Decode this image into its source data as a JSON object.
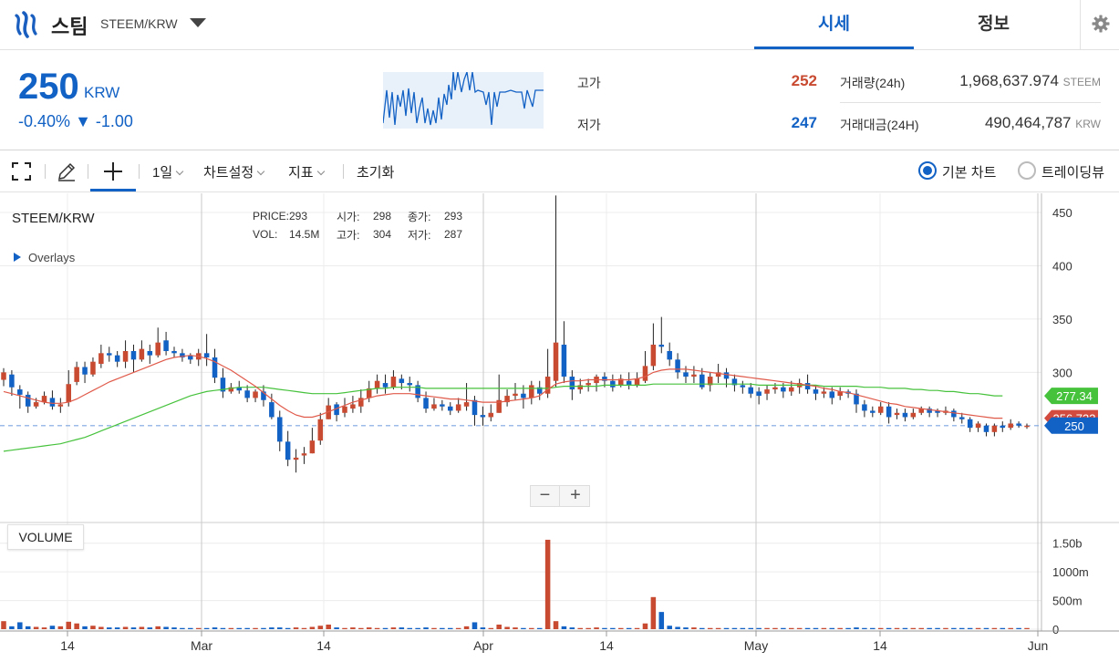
{
  "header": {
    "coin_name": "스팀",
    "pair": "STEEM/KRW",
    "tabs": [
      {
        "label": "시세",
        "active": true
      },
      {
        "label": "정보",
        "active": false
      }
    ]
  },
  "summary": {
    "price": "250",
    "unit": "KRW",
    "change_pct": "-0.40%",
    "change_abs": "▼ -1.00",
    "high_label": "고가",
    "high": "252",
    "low_label": "저가",
    "low": "247",
    "volume_label": "거래량(24h)",
    "volume": "1,968,637.974",
    "volume_unit": "STEEM",
    "amount_label": "거래대금(24H)",
    "amount": "490,464,787",
    "amount_unit": "KRW"
  },
  "toolbar": {
    "interval": "1일",
    "chart_settings": "차트설정",
    "indicators": "지표",
    "reset": "초기화",
    "basic_chart": "기본 차트",
    "tradingview": "트레이딩뷰"
  },
  "chart_panel": {
    "pair": "STEEM/KRW",
    "overlays": "Overlays",
    "volume_tag": "VOLUME",
    "legend": {
      "price_label": "PRICE:",
      "price": "293",
      "vol_label": "VOL:",
      "vol": "14.5M",
      "open_label": "시가:",
      "open": "298",
      "close_label": "종가:",
      "close": "293",
      "high_label": "고가:",
      "high": "304",
      "low_label": "저가:",
      "low": "287"
    },
    "zoom_out": "−",
    "zoom_in": "+"
  },
  "colors": {
    "up": "#c84a31",
    "down": "#1261c4",
    "ma_short": "#e05a4a",
    "ma_long": "#46c23c",
    "accent": "#1261c4"
  },
  "chart_data": {
    "type": "candlestick",
    "x_ticks": [
      "14",
      "Mar",
      "14",
      "Apr",
      "14",
      "May",
      "14",
      "Jun"
    ],
    "price_ticks": [
      450,
      400,
      350,
      300
    ],
    "price_ylim": [
      160,
      468
    ],
    "volume_ticks": [
      "1.50b",
      "1000m",
      "500m",
      "0"
    ],
    "volume_ylim": [
      0,
      1.75
    ],
    "current_price": 250,
    "ma_short_last": "256.733",
    "ma_long_last": "277.34",
    "candles": [
      [
        293,
        300,
        304,
        287,
        0.14
      ],
      [
        298,
        286,
        302,
        278,
        0.05
      ],
      [
        284,
        279,
        288,
        266,
        0.12
      ],
      [
        279,
        268,
        282,
        262,
        0.05
      ],
      [
        268,
        272,
        276,
        266,
        0.04
      ],
      [
        272,
        278,
        282,
        270,
        0.03
      ],
      [
        276,
        268,
        283,
        265,
        0.06
      ],
      [
        268,
        270,
        276,
        262,
        0.05
      ],
      [
        272,
        289,
        302,
        268,
        0.13
      ],
      [
        291,
        305,
        310,
        288,
        0.1
      ],
      [
        305,
        298,
        310,
        290,
        0.05
      ],
      [
        298,
        310,
        314,
        296,
        0.06
      ],
      [
        308,
        318,
        326,
        304,
        0.04
      ],
      [
        318,
        316,
        324,
        310,
        0.03
      ],
      [
        316,
        310,
        320,
        305,
        0.03
      ],
      [
        310,
        320,
        330,
        304,
        0.04
      ],
      [
        320,
        312,
        326,
        300,
        0.03
      ],
      [
        312,
        322,
        330,
        310,
        0.04
      ],
      [
        320,
        316,
        326,
        308,
        0.03
      ],
      [
        316,
        328,
        342,
        314,
        0.05
      ],
      [
        330,
        320,
        338,
        316,
        0.04
      ],
      [
        320,
        318,
        324,
        314,
        0.03
      ],
      [
        318,
        314,
        322,
        310,
        0.02
      ],
      [
        316,
        312,
        318,
        308,
        0.02
      ],
      [
        312,
        318,
        322,
        306,
        0.02
      ],
      [
        318,
        314,
        336,
        306,
        0.02
      ],
      [
        314,
        295,
        322,
        290,
        0.03
      ],
      [
        295,
        282,
        304,
        276,
        0.02
      ],
      [
        282,
        286,
        290,
        280,
        0.02
      ],
      [
        286,
        283,
        292,
        280,
        0.02
      ],
      [
        283,
        276,
        288,
        272,
        0.02
      ],
      [
        276,
        282,
        284,
        272,
        0.02
      ],
      [
        282,
        274,
        288,
        268,
        0.02
      ],
      [
        272,
        258,
        280,
        256,
        0.03
      ],
      [
        258,
        235,
        264,
        226,
        0.03
      ],
      [
        235,
        218,
        245,
        212,
        0.02
      ],
      [
        218,
        220,
        228,
        206,
        0.03
      ],
      [
        222,
        224,
        230,
        214,
        0.02
      ],
      [
        224,
        236,
        248,
        224,
        0.04
      ],
      [
        236,
        256,
        262,
        232,
        0.06
      ],
      [
        256,
        269,
        276,
        256,
        0.08
      ],
      [
        270,
        260,
        272,
        254,
        0.03
      ],
      [
        262,
        268,
        276,
        258,
        0.02
      ],
      [
        266,
        270,
        278,
        262,
        0.03
      ],
      [
        268,
        276,
        284,
        262,
        0.02
      ],
      [
        276,
        285,
        292,
        272,
        0.03
      ],
      [
        285,
        292,
        298,
        280,
        0.02
      ],
      [
        290,
        286,
        298,
        280,
        0.02
      ],
      [
        286,
        296,
        302,
        284,
        0.03
      ],
      [
        294,
        290,
        298,
        284,
        0.03
      ],
      [
        290,
        288,
        296,
        282,
        0.02
      ],
      [
        288,
        276,
        292,
        272,
        0.02
      ],
      [
        276,
        266,
        282,
        262,
        0.03
      ],
      [
        266,
        270,
        276,
        264,
        0.02
      ],
      [
        270,
        268,
        274,
        264,
        0.02
      ],
      [
        268,
        264,
        272,
        260,
        0.02
      ],
      [
        264,
        270,
        276,
        262,
        0.02
      ],
      [
        268,
        272,
        290,
        264,
        0.05
      ],
      [
        274,
        260,
        278,
        250,
        0.12
      ],
      [
        260,
        258,
        268,
        250,
        0.03
      ],
      [
        258,
        262,
        270,
        254,
        0.02
      ],
      [
        262,
        274,
        298,
        262,
        0.08
      ],
      [
        272,
        278,
        284,
        268,
        0.04
      ],
      [
        278,
        280,
        290,
        274,
        0.03
      ],
      [
        280,
        276,
        288,
        266,
        0.02
      ],
      [
        276,
        288,
        292,
        270,
        0.02
      ],
      [
        286,
        280,
        292,
        274,
        0.02
      ],
      [
        280,
        296,
        322,
        276,
        1.56
      ],
      [
        292,
        328,
        466,
        286,
        0.14
      ],
      [
        326,
        296,
        348,
        290,
        0.05
      ],
      [
        296,
        284,
        302,
        274,
        0.03
      ],
      [
        284,
        288,
        294,
        280,
        0.02
      ],
      [
        288,
        290,
        294,
        282,
        0.02
      ],
      [
        290,
        296,
        298,
        282,
        0.03
      ],
      [
        296,
        292,
        300,
        286,
        0.02
      ],
      [
        292,
        286,
        298,
        282,
        0.02
      ],
      [
        288,
        294,
        298,
        286,
        0.02
      ],
      [
        292,
        288,
        300,
        284,
        0.02
      ],
      [
        288,
        294,
        300,
        286,
        0.02
      ],
      [
        292,
        306,
        320,
        290,
        0.1
      ],
      [
        306,
        326,
        346,
        302,
        0.56
      ],
      [
        326,
        324,
        352,
        318,
        0.3
      ],
      [
        320,
        312,
        328,
        306,
        0.06
      ],
      [
        312,
        300,
        318,
        294,
        0.04
      ],
      [
        300,
        296,
        306,
        290,
        0.03
      ],
      [
        296,
        298,
        306,
        290,
        0.03
      ],
      [
        298,
        286,
        304,
        284,
        0.02
      ],
      [
        288,
        296,
        300,
        282,
        0.02
      ],
      [
        296,
        300,
        308,
        290,
        0.02
      ],
      [
        300,
        294,
        304,
        286,
        0.02
      ],
      [
        294,
        288,
        298,
        282,
        0.02
      ],
      [
        288,
        286,
        292,
        280,
        0.02
      ],
      [
        286,
        280,
        290,
        276,
        0.02
      ],
      [
        282,
        278,
        286,
        270,
        0.02
      ],
      [
        280,
        284,
        288,
        274,
        0.02
      ],
      [
        284,
        286,
        290,
        280,
        0.02
      ],
      [
        286,
        282,
        290,
        276,
        0.02
      ],
      [
        282,
        286,
        292,
        278,
        0.02
      ],
      [
        286,
        290,
        294,
        280,
        0.02
      ],
      [
        290,
        284,
        298,
        280,
        0.02
      ],
      [
        284,
        280,
        288,
        274,
        0.02
      ],
      [
        280,
        282,
        286,
        276,
        0.02
      ],
      [
        282,
        276,
        286,
        270,
        0.02
      ],
      [
        278,
        282,
        286,
        274,
        0.02
      ],
      [
        282,
        280,
        284,
        276,
        0.02
      ],
      [
        280,
        270,
        284,
        262,
        0.03
      ],
      [
        270,
        264,
        274,
        258,
        0.02
      ],
      [
        264,
        262,
        268,
        258,
        0.02
      ],
      [
        262,
        268,
        272,
        260,
        0.02
      ],
      [
        268,
        258,
        272,
        252,
        0.02
      ],
      [
        260,
        262,
        266,
        256,
        0.02
      ],
      [
        262,
        258,
        266,
        254,
        0.02
      ],
      [
        258,
        262,
        266,
        256,
        0.02
      ],
      [
        262,
        266,
        268,
        260,
        0.02
      ],
      [
        266,
        262,
        268,
        258,
        0.02
      ],
      [
        264,
        262,
        266,
        258,
        0.02
      ],
      [
        262,
        264,
        268,
        260,
        0.02
      ],
      [
        264,
        258,
        266,
        254,
        0.02
      ],
      [
        258,
        256,
        262,
        252,
        0.02
      ],
      [
        256,
        248,
        258,
        244,
        0.02
      ],
      [
        248,
        252,
        254,
        244,
        0.02
      ],
      [
        250,
        244,
        252,
        240,
        0.02
      ],
      [
        244,
        250,
        252,
        240,
        0.02
      ],
      [
        250,
        248,
        254,
        244,
        0.02
      ],
      [
        248,
        252,
        256,
        246,
        0.02
      ],
      [
        252,
        250,
        254,
        248,
        0.02
      ],
      [
        250,
        250,
        252,
        247,
        0.02
      ]
    ],
    "ma_short": [
      282,
      280,
      278,
      276,
      274,
      272,
      271,
      271,
      272,
      275,
      279,
      283,
      287,
      291,
      294,
      297,
      300,
      303,
      306,
      309,
      312,
      314,
      315,
      316,
      315,
      313,
      310,
      306,
      302,
      297,
      292,
      287,
      281,
      275,
      269,
      264,
      260,
      258,
      258,
      260,
      263,
      266,
      269,
      272,
      274,
      276,
      278,
      279,
      280,
      280,
      280,
      279,
      278,
      277,
      276,
      275,
      275,
      274,
      273,
      272,
      272,
      272,
      273,
      274,
      275,
      276,
      278,
      284,
      289,
      291,
      292,
      292,
      293,
      293,
      293,
      293,
      293,
      293,
      294,
      296,
      300,
      302,
      303,
      303,
      303,
      302,
      301,
      300,
      299,
      298,
      297,
      296,
      295,
      294,
      293,
      292,
      291,
      290,
      289,
      288,
      287,
      285,
      284,
      282,
      281,
      279,
      277,
      275,
      273,
      271,
      270,
      268,
      267,
      266,
      265,
      264,
      263,
      262,
      261,
      260,
      259,
      258,
      257,
      257
    ],
    "ma_long": [
      226,
      227,
      228,
      229,
      230,
      231,
      232,
      233,
      235,
      237,
      239,
      242,
      245,
      248,
      251,
      254,
      257,
      260,
      263,
      266,
      269,
      272,
      275,
      278,
      280,
      282,
      283,
      284,
      285,
      286,
      286,
      286,
      286,
      285,
      284,
      283,
      282,
      281,
      280,
      280,
      280,
      280,
      281,
      282,
      283,
      284,
      285,
      285,
      286,
      286,
      286,
      286,
      285,
      285,
      285,
      285,
      285,
      285,
      285,
      285,
      285,
      285,
      285,
      285,
      285,
      285,
      285,
      285,
      286,
      287,
      287,
      287,
      287,
      287,
      288,
      288,
      288,
      288,
      288,
      288,
      289,
      289,
      289,
      289,
      289,
      289,
      289,
      289,
      289,
      289,
      289,
      289,
      289,
      288,
      288,
      288,
      288,
      288,
      288,
      288,
      288,
      287,
      287,
      287,
      287,
      287,
      286,
      286,
      286,
      285,
      285,
      285,
      284,
      284,
      283,
      283,
      282,
      282,
      281,
      280,
      280,
      279,
      278,
      278
    ]
  }
}
